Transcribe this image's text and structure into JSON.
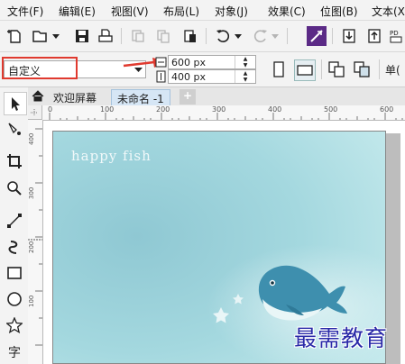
{
  "menu": [
    "文件(F)",
    "编辑(E)",
    "视图(V)",
    "布局(L)",
    "对象(J)",
    "效果(C)",
    "位图(B)",
    "文本(X)"
  ],
  "property_bar": {
    "preset": "自定义",
    "width": "600 px",
    "height": "400 px",
    "unit_label": "单("
  },
  "tabs": {
    "welcome": "欢迎屏幕",
    "document": "未命名 -1",
    "add": "+"
  },
  "ruler": {
    "h_ticks": [
      "0",
      "100",
      "200",
      "300",
      "400",
      "500",
      "600"
    ],
    "v_ticks": [
      "400",
      "300",
      "200",
      "100"
    ]
  },
  "artwork": {
    "title": "happy fish",
    "watermark": "最需教育"
  },
  "colors": {
    "highlight": "#e03a2f",
    "page_bg": "#9ed3dc",
    "whale": "#3e8fae"
  }
}
